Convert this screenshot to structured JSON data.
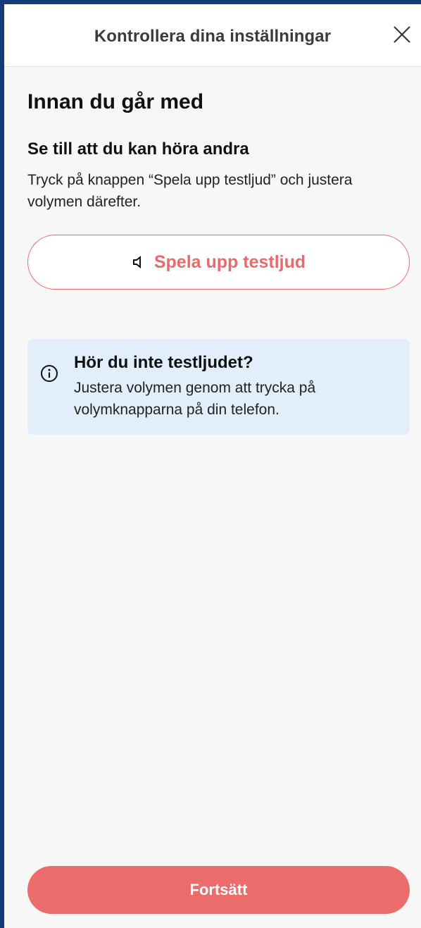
{
  "header": {
    "title": "Kontrollera dina inställningar",
    "close_icon": "close-icon"
  },
  "main": {
    "heading": "Innan du går med",
    "subheading": "Se till att du kan höra andra",
    "description": "Tryck på knappen “Spela upp testljud” och justera volymen därefter.",
    "play_button": {
      "icon": "speaker-icon",
      "label": "Spela upp testljud"
    },
    "info_box": {
      "icon": "info-icon",
      "title": "Hör du inte testljudet?",
      "body": "Justera volymen genom att trycka på volymknapparna på din telefon."
    }
  },
  "footer": {
    "continue_label": "Fortsätt"
  },
  "colors": {
    "accent": "#ec6b6b",
    "info_background": "#e2eef9",
    "frame_border": "#163a78"
  }
}
